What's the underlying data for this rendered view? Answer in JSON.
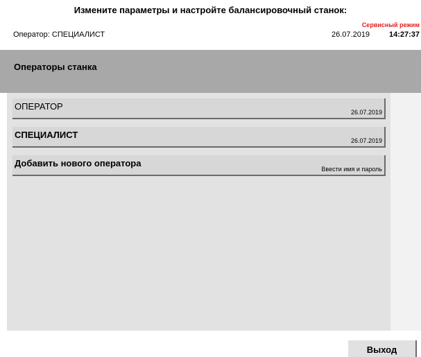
{
  "instruction": "Измените параметры и настройте балансировочный станок:",
  "status_bar": {
    "operator_label": "Оператор: СПЕЦИАЛИСТ",
    "mode": "Сервисный режим",
    "date": "26.07.2019",
    "time": "14:27:37"
  },
  "section": {
    "title": "Операторы станка"
  },
  "operators": [
    {
      "name": "ОПЕРАТОР",
      "meta": "26.07.2019",
      "bold": false
    },
    {
      "name": "СПЕЦИАЛИСТ",
      "meta": "26.07.2019",
      "bold": true
    },
    {
      "name": "Добавить нового оператора",
      "meta": "Ввести имя и пароль",
      "bold": true
    }
  ],
  "footer": {
    "exit_label": "Выход"
  },
  "colors": {
    "mode_badge": "#e31d1d",
    "header_bg": "#a8a8a8",
    "panel_bg": "#e2e2e2",
    "item_bg": "#d7d7d7"
  }
}
